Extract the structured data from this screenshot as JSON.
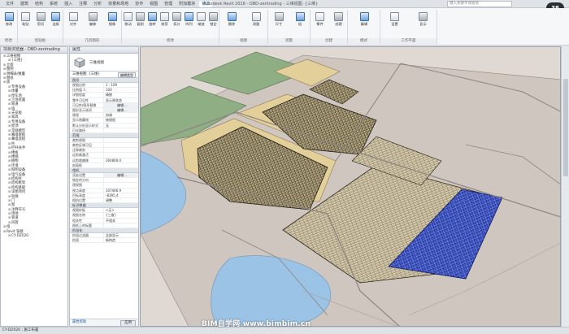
{
  "titlebar": {
    "tabs": [
      "文件",
      "建筑",
      "结构",
      "系统",
      "插入",
      "注释",
      "分析",
      "体量和场地",
      "协作",
      "视图",
      "管理",
      "附加模块",
      "修改"
    ],
    "active_tab_index": 12,
    "title": "Autodesk Revit 2016 -  DBD-zentrading - 三维视图: {三维}",
    "search_placeholder": "键入关键字或短语",
    "zoom": "38"
  },
  "ribbon": {
    "groups": [
      "修改",
      "剪贴板",
      "几何图形",
      "修改",
      "视图",
      "测量",
      "创建",
      "模式",
      "工作平面"
    ],
    "buttons": [
      "修改",
      "粘贴",
      "剪切",
      "连接",
      "对齐",
      "偏移",
      "镜像",
      "移动",
      "复制",
      "旋转",
      "修剪",
      "拆分",
      "阵列",
      "缩放",
      "锁定",
      "删除",
      "测量",
      "尺寸",
      "组",
      "零件",
      "创建",
      "编辑",
      "设置",
      "显示"
    ]
  },
  "browser": {
    "title": "项目浏览器 - DBD-zentrading",
    "rows": [
      "三维视图",
      "{三维}",
      "立面",
      "图例",
      "明细表/数量",
      "图纸",
      "族",
      "专用设备",
      "体量",
      "停车场",
      "卫浴装置",
      "坡道",
      "墙",
      "天花板",
      "家具",
      "专用设备",
      "屋顶",
      "常规模型",
      "幕墙嵌板",
      "幕墙竖梃",
      "柱",
      "栏杆扶手",
      "楼板",
      "楼梯",
      "植物",
      "环境",
      "照明设备",
      "电气设备",
      "结构柱",
      "结构框架",
      "结构基础",
      "详图项目",
      "轮廓",
      "门",
      "窗",
      "注释符号",
      "场地",
      "管道",
      "风管",
      "组",
      "Revit 链接",
      "CY-DZ020"
    ]
  },
  "properties": {
    "title": "属性",
    "type_name": "三维视图",
    "filter_label": "三维视图: {三维}",
    "edit_type": "编辑类型",
    "sections": [
      {
        "name": "图形",
        "rows": [
          [
            "视图比例",
            "1 : 100"
          ],
          [
            "比例值 1:",
            "100"
          ],
          [
            "详细程度",
            "精细"
          ],
          [
            "零件可见性",
            "显示原状态"
          ],
          [
            "可见性/图形替换",
            "编辑..."
          ],
          [
            "图形显示选项",
            "编辑..."
          ],
          [
            "规程",
            "协调"
          ],
          [
            "显示隐藏线",
            "按规程"
          ],
          [
            "默认分析显示样式",
            "无"
          ],
          [
            "日光路径",
            ""
          ]
        ]
      },
      {
        "name": "范围",
        "rows": [
          [
            "裁剪视图",
            ""
          ],
          [
            "裁剪区域可见",
            ""
          ],
          [
            "注释裁剪",
            ""
          ],
          [
            "远剪裁激活",
            ""
          ],
          [
            "远剪裁偏移",
            "304800.0"
          ],
          [
            "剖面框",
            ""
          ]
        ]
      },
      {
        "name": "相机",
        "rows": [
          [
            "渲染设置",
            "编辑..."
          ],
          [
            "锁定的方向",
            ""
          ],
          [
            "透视图",
            ""
          ],
          [
            "视点高度",
            "107466.9"
          ],
          [
            "目标高度",
            "-8395.4"
          ],
          [
            "相机位置",
            "调整"
          ]
        ]
      },
      {
        "name": "标识数据",
        "rows": [
          [
            "视图样板",
            "<无>"
          ],
          [
            "视图名称",
            "{三维}"
          ],
          [
            "相关性",
            "不相关"
          ],
          [
            "图纸上的标题",
            ""
          ]
        ]
      },
      {
        "name": "阶段化",
        "rows": [
          [
            "阶段过滤器",
            "全部显示"
          ],
          [
            "阶段",
            "新构造"
          ]
        ]
      }
    ],
    "help_link": "属性帮助",
    "apply_label": "应用"
  },
  "viewport": {
    "label": "3D model view"
  },
  "status": {
    "left": "CY-DZ020 : 施工布置",
    "watermark": "BIM自学网 www.bimbim.cn"
  },
  "colors": {
    "green_plot": "#8fae84",
    "tan_plot": "#e3cf9a",
    "water": "#9bc3e6",
    "ground": "#cfc6bf",
    "blue_building": "#2337a0",
    "accent": "#1a5fa5"
  }
}
